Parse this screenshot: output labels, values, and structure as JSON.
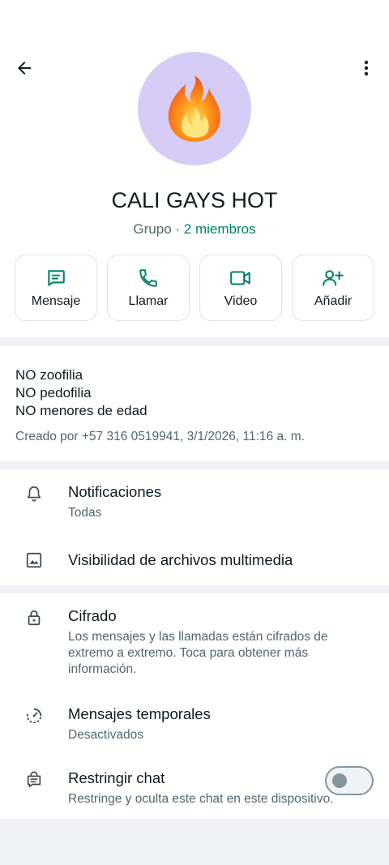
{
  "header": {
    "back_icon": "arrow-left-icon",
    "more_icon": "more-vertical-icon"
  },
  "group": {
    "avatar_icon": "fire-emoji",
    "name": "CALI GAYS HOT",
    "type_label": "Grupo",
    "separator": " · ",
    "members_label": "2 miembros"
  },
  "actions": [
    {
      "label": "Mensaje",
      "icon": "message-icon"
    },
    {
      "label": "Llamar",
      "icon": "phone-icon"
    },
    {
      "label": "Video",
      "icon": "video-icon"
    },
    {
      "label": "Añadir",
      "icon": "add-person-icon"
    }
  ],
  "description": {
    "lines": [
      "NO zoofilia",
      "NO pedofilia",
      "NO menores de edad"
    ],
    "created_by": "Creado por +57 316 0519941, 3/1/2026, 11:16 a. m."
  },
  "settings": {
    "notifications": {
      "title": "Notificaciones",
      "subtitle": "Todas",
      "icon": "bell-icon"
    },
    "media_visibility": {
      "title": "Visibilidad de archivos multimedia",
      "icon": "image-icon"
    },
    "encryption": {
      "title": "Cifrado",
      "subtitle": "Los mensajes y las llamadas están cifrados de extremo a extremo. Toca para obtener más información.",
      "icon": "lock-icon"
    },
    "disappearing": {
      "title": "Mensajes temporales",
      "subtitle": "Desactivados",
      "icon": "timer-icon"
    },
    "restrict_chat": {
      "title": "Restringir chat",
      "subtitle": "Restringe y oculta este chat en este dispositivo.",
      "icon": "lock-chat-icon",
      "enabled": false
    }
  },
  "colors": {
    "accent": "#008069",
    "avatar_bg": "#d6cdf7",
    "text_primary": "#111b21",
    "text_secondary": "#54656f"
  }
}
